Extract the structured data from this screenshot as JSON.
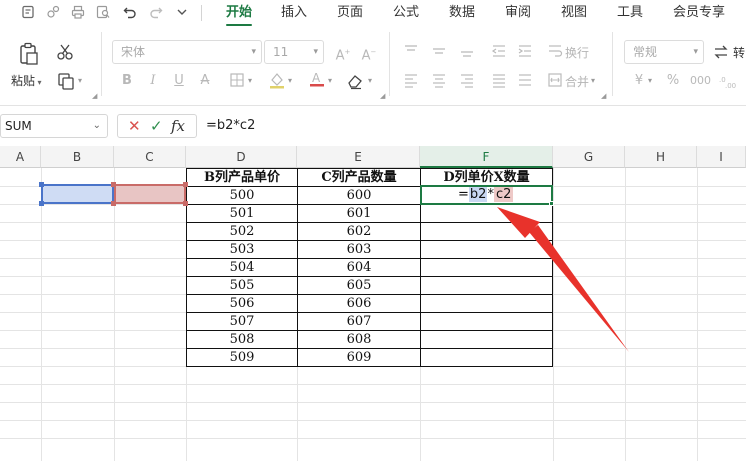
{
  "menu": {
    "tabs": [
      {
        "label": "开始",
        "active": true
      },
      {
        "label": "插入",
        "active": false
      },
      {
        "label": "页面",
        "active": false
      },
      {
        "label": "公式",
        "active": false
      },
      {
        "label": "数据",
        "active": false
      },
      {
        "label": "审阅",
        "active": false
      },
      {
        "label": "视图",
        "active": false
      },
      {
        "label": "工具",
        "active": false
      },
      {
        "label": "会员专享",
        "active": false
      }
    ],
    "quick_access_icons": [
      "file-icon",
      "share-icon",
      "print-icon",
      "preview-icon",
      "undo-icon",
      "redo-icon",
      "more-icon"
    ],
    "accent_color": "#1d7a43"
  },
  "ribbon": {
    "paste_label": "粘贴",
    "font_name": "宋体",
    "font_size": "11",
    "wrap_label": "换行",
    "merge_label": "合并",
    "number_format": "常规",
    "convert_label": "转",
    "currency_symbol": "¥",
    "percent_symbol": "%"
  },
  "formula_bar": {
    "name_box": "SUM",
    "cancel_symbol": "✕",
    "confirm_symbol": "✓",
    "fx_symbol": "fx",
    "formula": "=b2*c2"
  },
  "sheet": {
    "columns": [
      "A",
      "B",
      "C",
      "D",
      "E",
      "F",
      "G",
      "H",
      "I"
    ],
    "selected_column": "F",
    "table": {
      "headers": [
        "B列产品单价",
        "C列产品数量",
        "D列单价X数量"
      ],
      "rows": [
        [
          "500",
          "600"
        ],
        [
          "501",
          "601"
        ],
        [
          "502",
          "602"
        ],
        [
          "503",
          "603"
        ],
        [
          "504",
          "604"
        ],
        [
          "505",
          "605"
        ],
        [
          "506",
          "606"
        ],
        [
          "507",
          "607"
        ],
        [
          "508",
          "608"
        ],
        [
          "509",
          "609"
        ]
      ]
    },
    "editing_cell": {
      "prefix": "=",
      "ref1": "b2",
      "operator": "*",
      "ref2": "c2"
    },
    "ref_colors": {
      "b2": "#4a74c9",
      "c2": "#c96b68"
    },
    "annotation_arrow_color": "#e8322b"
  }
}
